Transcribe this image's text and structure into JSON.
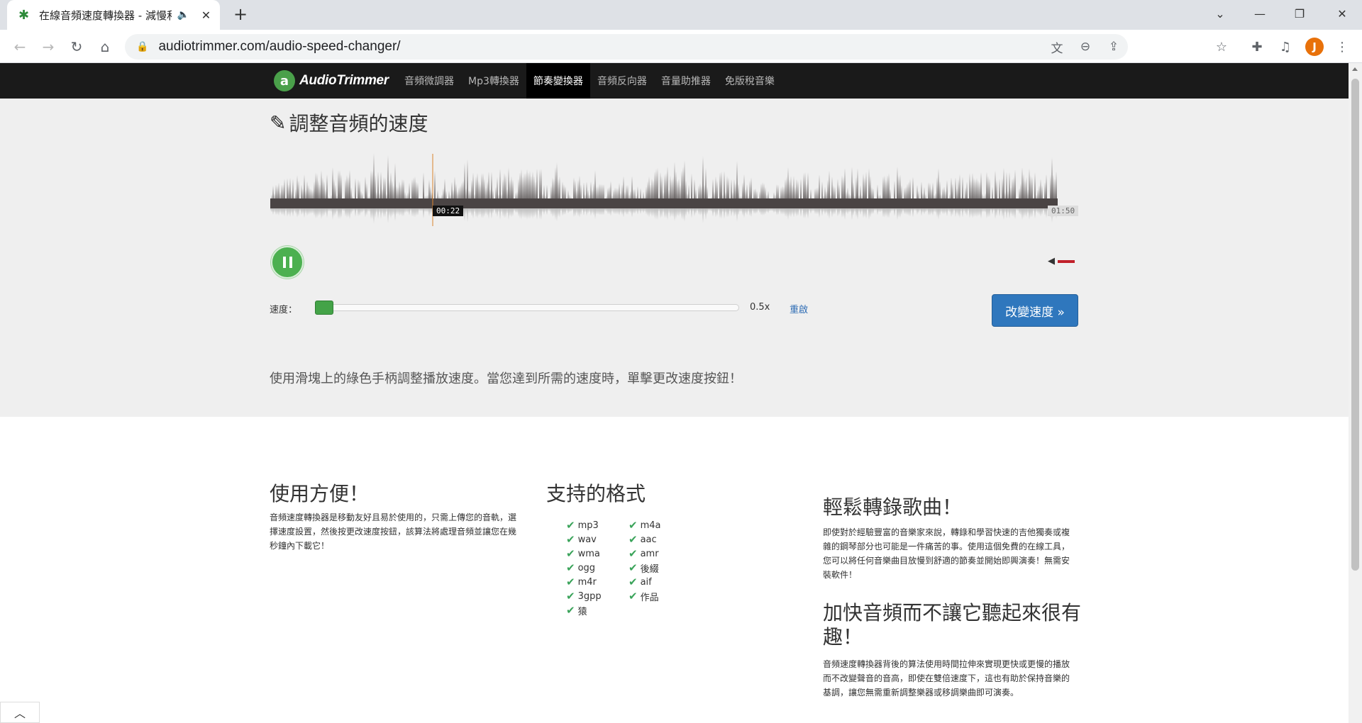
{
  "browser": {
    "tab_title": "在線音頻速度轉換器 - 減慢和",
    "url": "audiotrimmer.com/audio-speed-changer/",
    "profile_initial": "J"
  },
  "site": {
    "logo_text": "AudioTrimmer",
    "nav": [
      {
        "label": "音頻微調器",
        "active": false
      },
      {
        "label": "Mp3轉換器",
        "active": false
      },
      {
        "label": "節奏變換器",
        "active": true
      },
      {
        "label": "音頻反向器",
        "active": false
      },
      {
        "label": "音量助推器",
        "active": false
      },
      {
        "label": "免版稅音樂",
        "active": false
      }
    ]
  },
  "tool": {
    "title": "調整音頻的速度",
    "current_time": "00:22",
    "total_time": "01:50",
    "speed_label": "速度：",
    "speed_value": "0.5x",
    "reset_label": "重啟",
    "change_button": "改變速度 »",
    "instructions": "使用滑塊上的綠色手柄調整播放速度。當您達到所需的速度時，單擊更改速度按鈕！"
  },
  "columns": {
    "easy": {
      "title": "使用方便！",
      "text": "音頻速度轉換器是移動友好且易於使用的，只需上傳您的音軌，選擇速度設置，然後按更改速度按鈕，該算法將處理音頻並讓您在幾秒鐘內下載它！"
    },
    "formats": {
      "title": "支持的格式",
      "items": [
        "mp3",
        "m4a",
        "wav",
        "aac",
        "wma",
        "amr",
        "ogg",
        "後綴",
        "m4r",
        "aif",
        "3gpp",
        "作品",
        "猿"
      ]
    },
    "transcribe": {
      "title": "輕鬆轉錄歌曲！",
      "text": "即使對於經驗豐富的音樂家來說，轉錄和學習快速的吉他獨奏或複雜的鋼琴部分也可能是一件痛苦的事。使用這個免費的在線工具，您可以將任何音樂曲目放慢到舒適的節奏並開始即興演奏！無需安裝軟件！"
    },
    "speedup": {
      "title": "加快音頻而不讓它聽起來很有趣！",
      "text": "音頻速度轉換器背後的算法使用時間拉伸來實現更快或更慢的播放而不改變聲音的音高，即使在雙倍速度下，這也有助於保持音樂的基調，讓您無需重新調整樂器或移調樂曲即可演奏。"
    }
  }
}
